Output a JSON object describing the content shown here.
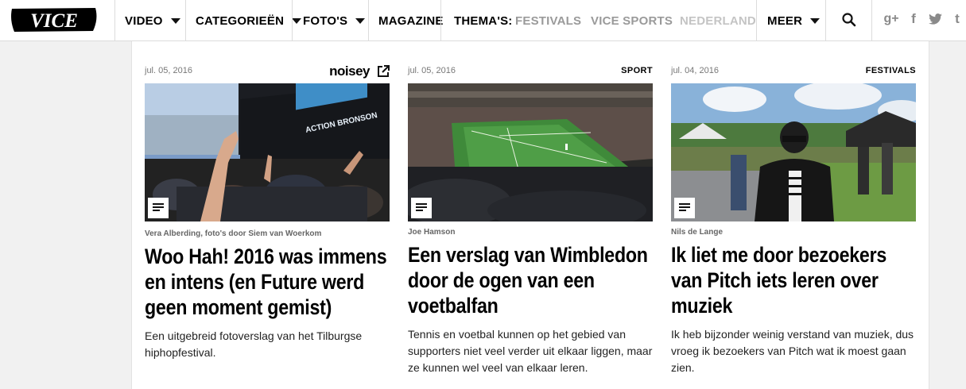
{
  "nav": {
    "logo_text": "VICE",
    "video": "VIDEO",
    "categories": "CATEGORIEËN",
    "photos": "FOTO'S",
    "magazine": "MAGAZINE",
    "themes_label": "THEMA'S:",
    "theme_festivals": "FESTIVALS",
    "theme_sports": "VICE SPORTS",
    "theme_nederland": "NEDERLAND",
    "more": "MEER",
    "icons": [
      "search-icon",
      "google-plus-icon",
      "facebook-icon",
      "twitter-icon",
      "tumblr-icon"
    ],
    "social": {
      "gplus": "g+",
      "facebook": "f",
      "tumblr": "t"
    }
  },
  "articles": [
    {
      "date": "jul. 05, 2016",
      "section": "",
      "brand": "noisey",
      "byline": "Vera Alberding, foto's door Siem van Woerkom",
      "title": "Woo Hah! 2016 was immens en intens (en Future werd geen moment gemist)",
      "description": "Een uitgebreid fotoverslag van het Tilburgse hiphopfestival.",
      "image_icon": "festival-stage-photo"
    },
    {
      "date": "jul. 05, 2016",
      "section": "SPORT",
      "byline": "Joe Hamson",
      "title": "Een verslag van Wimbledon door de ogen van een voetbalfan",
      "description": "Tennis en voetbal kunnen op het gebied van supporters niet veel verder uit elkaar liggen, maar ze kunnen wel veel van elkaar leren.",
      "image_icon": "tennis-court-photo"
    },
    {
      "date": "jul. 04, 2016",
      "section": "FESTIVALS",
      "byline": "Nils de Lange",
      "title": "Ik liet me door bezoekers van Pitch iets leren over muziek",
      "description": "Ik heb bijzonder weinig verstand van muziek, dus vroeg ik bezoekers van Pitch wat ik moest gaan zien.",
      "image_icon": "festival-visitor-photo"
    }
  ],
  "colors": {
    "accent": "#000000",
    "muted": "#9a9a9a",
    "background": "#f1f1f1"
  }
}
